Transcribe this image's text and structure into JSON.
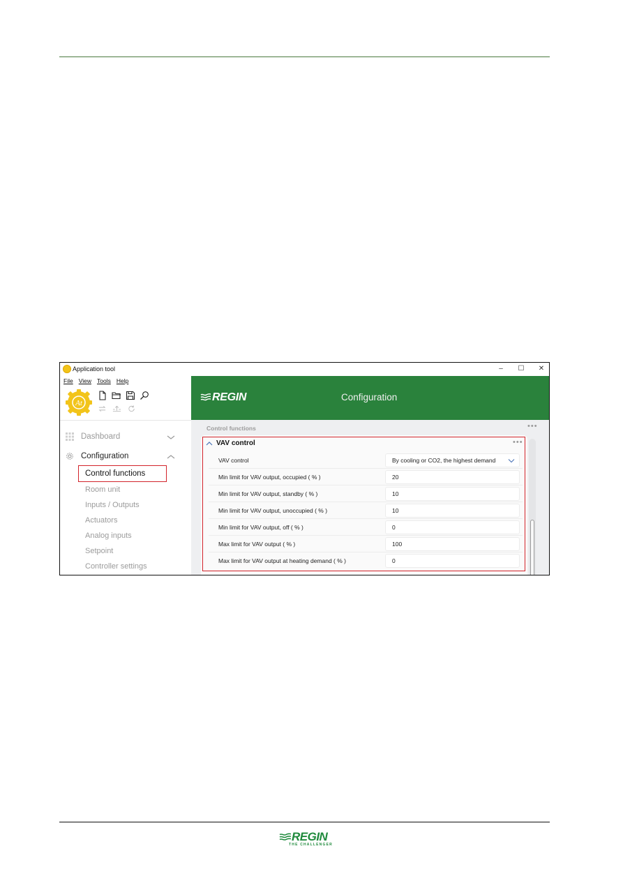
{
  "window": {
    "title": "Application tool",
    "controls": {
      "minimize": "–",
      "maximize": "☐",
      "close": "✕"
    }
  },
  "menu": [
    "File",
    "View",
    "Tools",
    "Help"
  ],
  "toolbar": {
    "row1": [
      "new-file-icon",
      "open-folder-icon",
      "save-icon",
      "search-icon"
    ],
    "row2": [
      "transfer-icon",
      "upload-icon",
      "refresh-icon"
    ]
  },
  "header": {
    "brand": "REGIN",
    "page_title": "Configuration"
  },
  "sidebar": {
    "main": [
      {
        "label": "Dashboard",
        "icon": "grid-icon",
        "expanded": false
      },
      {
        "label": "Configuration",
        "icon": "gear-icon",
        "expanded": true
      }
    ],
    "sub": [
      {
        "label": "Control functions",
        "active": true
      },
      {
        "label": "Room unit",
        "active": false
      },
      {
        "label": "Inputs / Outputs",
        "active": false
      },
      {
        "label": "Actuators",
        "active": false
      },
      {
        "label": "Analog inputs",
        "active": false
      },
      {
        "label": "Setpoint",
        "active": false
      },
      {
        "label": "Controller settings",
        "active": false
      }
    ]
  },
  "content": {
    "breadcrumb": "Control functions",
    "more_label": "•••",
    "section": {
      "title": "VAV control",
      "rows": [
        {
          "label": "VAV control",
          "value": "By cooling or CO2, the highest demand",
          "type": "dropdown"
        },
        {
          "label": "Min limit for VAV output, occupied ( % )",
          "value": "20",
          "type": "input"
        },
        {
          "label": "Min limit for VAV output, standby ( % )",
          "value": "10",
          "type": "input"
        },
        {
          "label": "Min limit for VAV output, unoccupied ( % )",
          "value": "10",
          "type": "input"
        },
        {
          "label": "Min limit for VAV output, off ( % )",
          "value": "0",
          "type": "input"
        },
        {
          "label": "Max limit for VAV output ( % )",
          "value": "100",
          "type": "input"
        },
        {
          "label": "Max limit for VAV output at heating demand ( % )",
          "value": "0",
          "type": "input"
        }
      ]
    }
  },
  "footer": {
    "brand": "REGIN",
    "tagline": "THE CHALLENGER"
  },
  "colors": {
    "header_green": "#2a823c",
    "highlight_red": "#d2232a",
    "brand_green": "#1f8a3c"
  }
}
